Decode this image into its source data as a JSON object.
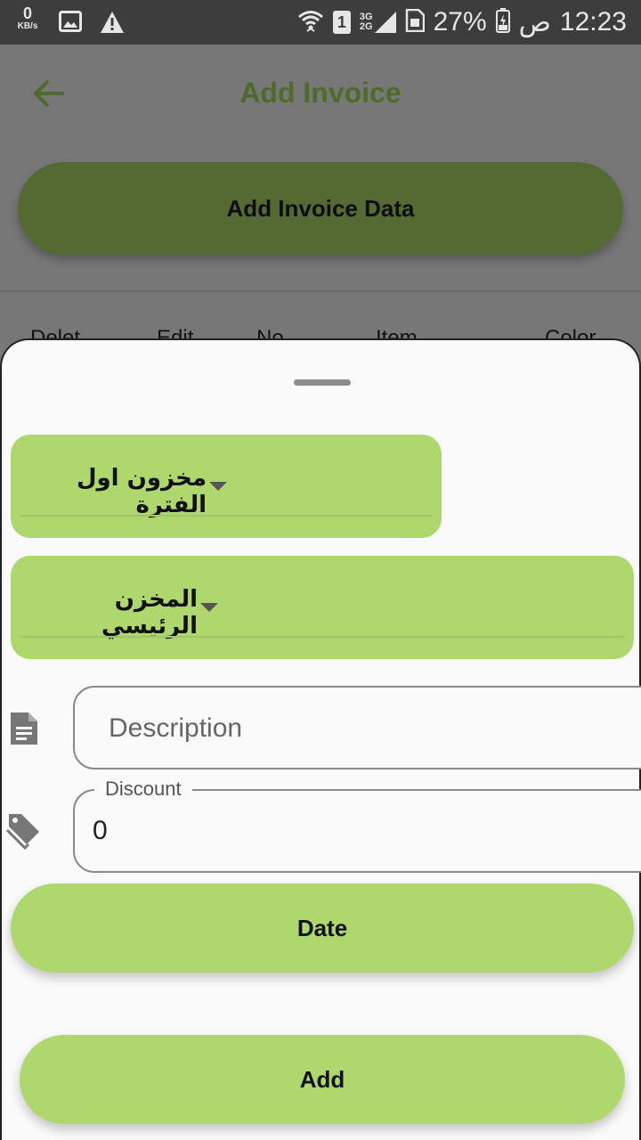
{
  "status_bar": {
    "net_speed_value": "0",
    "net_speed_unit": "KB/s",
    "sim_slot": "1",
    "net_3g": "3G",
    "net_2g": "2G",
    "battery_percent": "27%",
    "am_pm": "ص",
    "time": "12:23"
  },
  "app_bar": {
    "title": "Add Invoice"
  },
  "main": {
    "add_invoice_data_label": "Add Invoice Data",
    "table_headers": [
      "Delet",
      "Edit",
      "No",
      "Item",
      "Color"
    ]
  },
  "sheet": {
    "dropdown_period": {
      "selected": "مخزون اول الفترة"
    },
    "dropdown_store": {
      "selected": "المخزن الرئيسي"
    },
    "description": {
      "placeholder": "Description",
      "value": ""
    },
    "discount": {
      "label": "Discount",
      "value": "0"
    },
    "date_label": "Date",
    "add_label": "Add"
  },
  "colors": {
    "accent": "#aed86e",
    "title_green": "#4f6a2b",
    "dim_button": "#556a33"
  }
}
